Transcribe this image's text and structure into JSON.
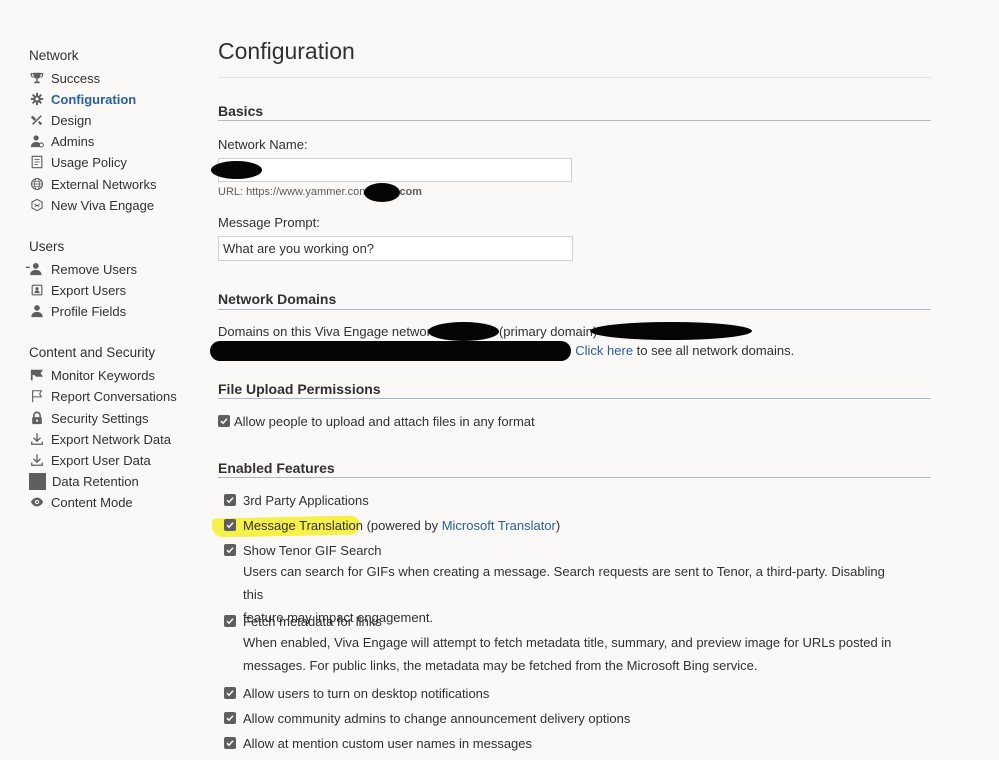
{
  "sidebar": {
    "groups": [
      {
        "title": "Network",
        "items": [
          {
            "label": "Success",
            "icon": "trophy-icon"
          },
          {
            "label": "Configuration",
            "icon": "gear-icon",
            "active": true
          },
          {
            "label": "Design",
            "icon": "design-tools-icon"
          },
          {
            "label": "Admins",
            "icon": "admin-person-icon"
          },
          {
            "label": "Usage Policy",
            "icon": "document-icon"
          },
          {
            "label": "External Networks",
            "icon": "globe-icon"
          },
          {
            "label": "New Viva Engage",
            "icon": "viva-engage-icon"
          }
        ]
      },
      {
        "title": "Users",
        "items": [
          {
            "label": "Remove Users",
            "icon": "remove-user-icon"
          },
          {
            "label": "Export Users",
            "icon": "export-users-icon"
          },
          {
            "label": "Profile Fields",
            "icon": "person-icon"
          }
        ]
      },
      {
        "title": "Content and Security",
        "items": [
          {
            "label": "Monitor Keywords",
            "icon": "flag-filled-icon"
          },
          {
            "label": "Report Conversations",
            "icon": "flag-outline-icon"
          },
          {
            "label": "Security Settings",
            "icon": "lock-icon"
          },
          {
            "label": "Export Network Data",
            "icon": "download-icon"
          },
          {
            "label": "Export User Data",
            "icon": "download-icon"
          },
          {
            "label": "Data Retention",
            "icon": "square-icon"
          },
          {
            "label": "Content Mode",
            "icon": "eye-icon"
          }
        ]
      }
    ]
  },
  "main": {
    "title": "Configuration",
    "basics": {
      "heading": "Basics",
      "network_name_label": "Network Name:",
      "network_name_value": "",
      "url_prefix": "URL: https://www.yammer.con",
      "url_suffix": "com",
      "message_prompt_label": "Message Prompt:",
      "message_prompt_value": "What are you working on?"
    },
    "network_domains": {
      "heading": "Network Domains",
      "line1_prefix": "Domains on this Viva Engage networ",
      "line1_middle": "(primary domain)",
      "line2_dot": ".",
      "click_here": "Click here",
      "line2_suffix": " to see all network domains."
    },
    "file_upload": {
      "heading": "File Upload Permissions",
      "allow_upload_label": "Allow people to upload and attach files in any format",
      "checked": true
    },
    "features": {
      "heading": "Enabled Features",
      "third_party": "3rd Party Applications",
      "message_translation": "Message Translation",
      "powered_by_prefix": " (powered by ",
      "microsoft_translator": "Microsoft Translator",
      "powered_by_suffix": ")",
      "tenor": "Show Tenor GIF Search",
      "tenor_desc_1": "Users can search for GIFs when creating a message. Search requests are sent to Tenor, a third-party. Disabling this",
      "tenor_desc_2": "feature may impact engagement.",
      "fetch_metadata": "Fetch metadata for links",
      "fetch_desc_1": "When enabled, Viva Engage will attempt to fetch metadata title, summary, and preview image for URLs posted in",
      "fetch_desc_2": "messages. For public links, the metadata may be fetched from the Microsoft Bing service.",
      "desktop_notifications": "Allow users to turn on desktop notifications",
      "announcement_delivery": "Allow community admins to change announcement delivery options",
      "mention_names": "Allow at mention custom user names in messages"
    }
  },
  "colors": {
    "accent": "#2a5ea8",
    "highlight": "#f7f047",
    "checkbox": "#605e5c",
    "section_rule": "#a9b8cc"
  }
}
